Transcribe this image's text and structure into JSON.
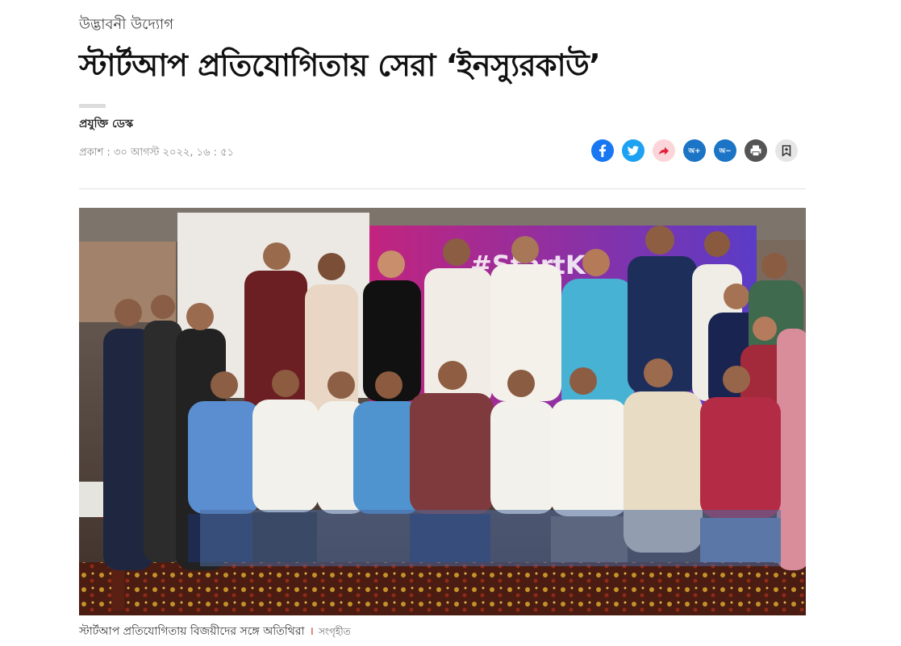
{
  "article": {
    "kicker": "উদ্ভাবনী উদ্যোগ",
    "headline": "স্টার্টআপ প্রতিযোগিতায় সেরা ‘ইনস্যুরকাউ’",
    "author": "প্রযুক্তি ডেস্ক",
    "published": "প্রকাশ : ৩০ আগস্ট ২০২২, ১৬ : ৫১"
  },
  "actions": {
    "facebook": {
      "icon": "facebook-icon",
      "color": "#1877f2"
    },
    "twitter": {
      "icon": "twitter-icon",
      "color": "#1da1f2"
    },
    "share": {
      "icon": "share-arrow-icon",
      "color": "#f9d3d8"
    },
    "font_increase": {
      "label": "অ+",
      "color": "#1b74c5"
    },
    "font_decrease": {
      "label": "অ−",
      "color": "#1b74c5"
    },
    "print": {
      "icon": "print-icon",
      "color": "#555555"
    },
    "bookmark": {
      "icon": "bookmark-icon",
      "color": "#e6e6e6"
    }
  },
  "photo": {
    "banner_text": "#StartKo"
  },
  "caption": {
    "text": "স্টার্টআপ প্রতিযোগিতায় বিজয়ীদের সঙ্গে অতিথিরা",
    "separator": "।",
    "credit": "সংগৃহীত"
  }
}
